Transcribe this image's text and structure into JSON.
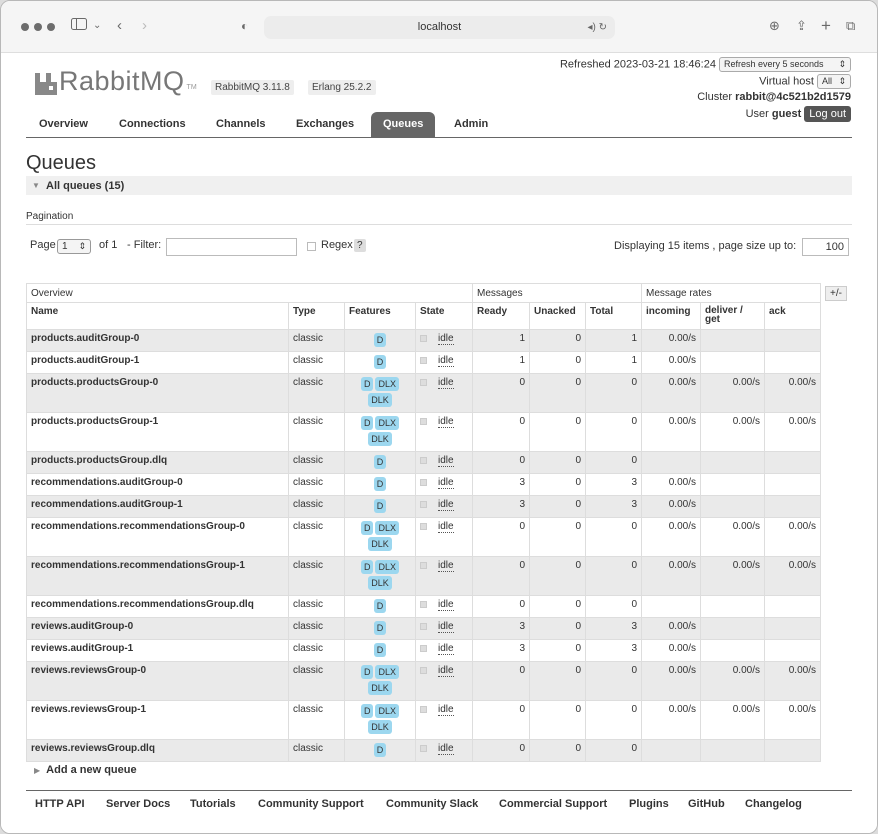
{
  "browser": {
    "url": "localhost"
  },
  "header": {
    "brand": "RabbitMQ",
    "tm": "TM",
    "version": "RabbitMQ 3.11.8",
    "erlang": "Erlang 25.2.2",
    "refreshed": "Refreshed 2023-03-21 18:46:24",
    "refresh_option": "Refresh every 5 seconds",
    "vhost_label": "Virtual host",
    "vhost_value": "All",
    "cluster_label": "Cluster",
    "cluster_value": "rabbit@4c521b2d1579",
    "user_label": "User",
    "user_value": "guest",
    "logout": "Log out"
  },
  "tabs": [
    "Overview",
    "Connections",
    "Channels",
    "Exchanges",
    "Queues",
    "Admin"
  ],
  "page_title": "Queues",
  "section_title": "All queues (15)",
  "pagination": {
    "label": "Pagination",
    "page_label": "Page",
    "page_value": "1",
    "of_label": "of 1",
    "filter_label": "- Filter:",
    "regex_label": "Regex",
    "help": "?",
    "display_text": "Displaying 15 items , page size up to:",
    "page_size": "100"
  },
  "table": {
    "groups": {
      "overview": "Overview",
      "messages": "Messages",
      "rates": "Message rates",
      "toggle": "+/-"
    },
    "headers": [
      "Name",
      "Type",
      "Features",
      "State",
      "Ready",
      "Unacked",
      "Total",
      "incoming",
      "deliver / get",
      "ack"
    ],
    "rows": [
      {
        "name": "products.auditGroup-0",
        "type": "classic",
        "features": [
          "D"
        ],
        "state": "idle",
        "ready": "1",
        "unacked": "0",
        "total": "1",
        "incoming": "0.00/s",
        "deliver": "",
        "ack": ""
      },
      {
        "name": "products.auditGroup-1",
        "type": "classic",
        "features": [
          "D"
        ],
        "state": "idle",
        "ready": "1",
        "unacked": "0",
        "total": "1",
        "incoming": "0.00/s",
        "deliver": "",
        "ack": ""
      },
      {
        "name": "products.productsGroup-0",
        "type": "classic",
        "features": [
          "D",
          "DLX",
          "DLK"
        ],
        "state": "idle",
        "ready": "0",
        "unacked": "0",
        "total": "0",
        "incoming": "0.00/s",
        "deliver": "0.00/s",
        "ack": "0.00/s"
      },
      {
        "name": "products.productsGroup-1",
        "type": "classic",
        "features": [
          "D",
          "DLX",
          "DLK"
        ],
        "state": "idle",
        "ready": "0",
        "unacked": "0",
        "total": "0",
        "incoming": "0.00/s",
        "deliver": "0.00/s",
        "ack": "0.00/s"
      },
      {
        "name": "products.productsGroup.dlq",
        "type": "classic",
        "features": [
          "D"
        ],
        "state": "idle",
        "ready": "0",
        "unacked": "0",
        "total": "0",
        "incoming": "",
        "deliver": "",
        "ack": ""
      },
      {
        "name": "recommendations.auditGroup-0",
        "type": "classic",
        "features": [
          "D"
        ],
        "state": "idle",
        "ready": "3",
        "unacked": "0",
        "total": "3",
        "incoming": "0.00/s",
        "deliver": "",
        "ack": ""
      },
      {
        "name": "recommendations.auditGroup-1",
        "type": "classic",
        "features": [
          "D"
        ],
        "state": "idle",
        "ready": "3",
        "unacked": "0",
        "total": "3",
        "incoming": "0.00/s",
        "deliver": "",
        "ack": ""
      },
      {
        "name": "recommendations.recommendationsGroup-0",
        "type": "classic",
        "features": [
          "D",
          "DLX",
          "DLK"
        ],
        "state": "idle",
        "ready": "0",
        "unacked": "0",
        "total": "0",
        "incoming": "0.00/s",
        "deliver": "0.00/s",
        "ack": "0.00/s"
      },
      {
        "name": "recommendations.recommendationsGroup-1",
        "type": "classic",
        "features": [
          "D",
          "DLX",
          "DLK"
        ],
        "state": "idle",
        "ready": "0",
        "unacked": "0",
        "total": "0",
        "incoming": "0.00/s",
        "deliver": "0.00/s",
        "ack": "0.00/s"
      },
      {
        "name": "recommendations.recommendationsGroup.dlq",
        "type": "classic",
        "features": [
          "D"
        ],
        "state": "idle",
        "ready": "0",
        "unacked": "0",
        "total": "0",
        "incoming": "",
        "deliver": "",
        "ack": ""
      },
      {
        "name": "reviews.auditGroup-0",
        "type": "classic",
        "features": [
          "D"
        ],
        "state": "idle",
        "ready": "3",
        "unacked": "0",
        "total": "3",
        "incoming": "0.00/s",
        "deliver": "",
        "ack": ""
      },
      {
        "name": "reviews.auditGroup-1",
        "type": "classic",
        "features": [
          "D"
        ],
        "state": "idle",
        "ready": "3",
        "unacked": "0",
        "total": "3",
        "incoming": "0.00/s",
        "deliver": "",
        "ack": ""
      },
      {
        "name": "reviews.reviewsGroup-0",
        "type": "classic",
        "features": [
          "D",
          "DLX",
          "DLK"
        ],
        "state": "idle",
        "ready": "0",
        "unacked": "0",
        "total": "0",
        "incoming": "0.00/s",
        "deliver": "0.00/s",
        "ack": "0.00/s"
      },
      {
        "name": "reviews.reviewsGroup-1",
        "type": "classic",
        "features": [
          "D",
          "DLX",
          "DLK"
        ],
        "state": "idle",
        "ready": "0",
        "unacked": "0",
        "total": "0",
        "incoming": "0.00/s",
        "deliver": "0.00/s",
        "ack": "0.00/s"
      },
      {
        "name": "reviews.reviewsGroup.dlq",
        "type": "classic",
        "features": [
          "D"
        ],
        "state": "idle",
        "ready": "0",
        "unacked": "0",
        "total": "0",
        "incoming": "",
        "deliver": "",
        "ack": ""
      }
    ]
  },
  "add_queue": "Add a new queue",
  "footer": [
    "HTTP API",
    "Server Docs",
    "Tutorials",
    "Community Support",
    "Community Slack",
    "Commercial Support",
    "Plugins",
    "GitHub",
    "Changelog"
  ],
  "icons": {
    "back": "chevron-left-icon",
    "forward": "chevron-right-icon",
    "sidebar": "sidebar-icon",
    "shield": "shield-icon",
    "sound": "speaker-icon",
    "reload": "reload-icon",
    "download": "download-icon",
    "share": "share-icon",
    "new_tab": "plus-icon",
    "tabs": "tabs-icon"
  }
}
